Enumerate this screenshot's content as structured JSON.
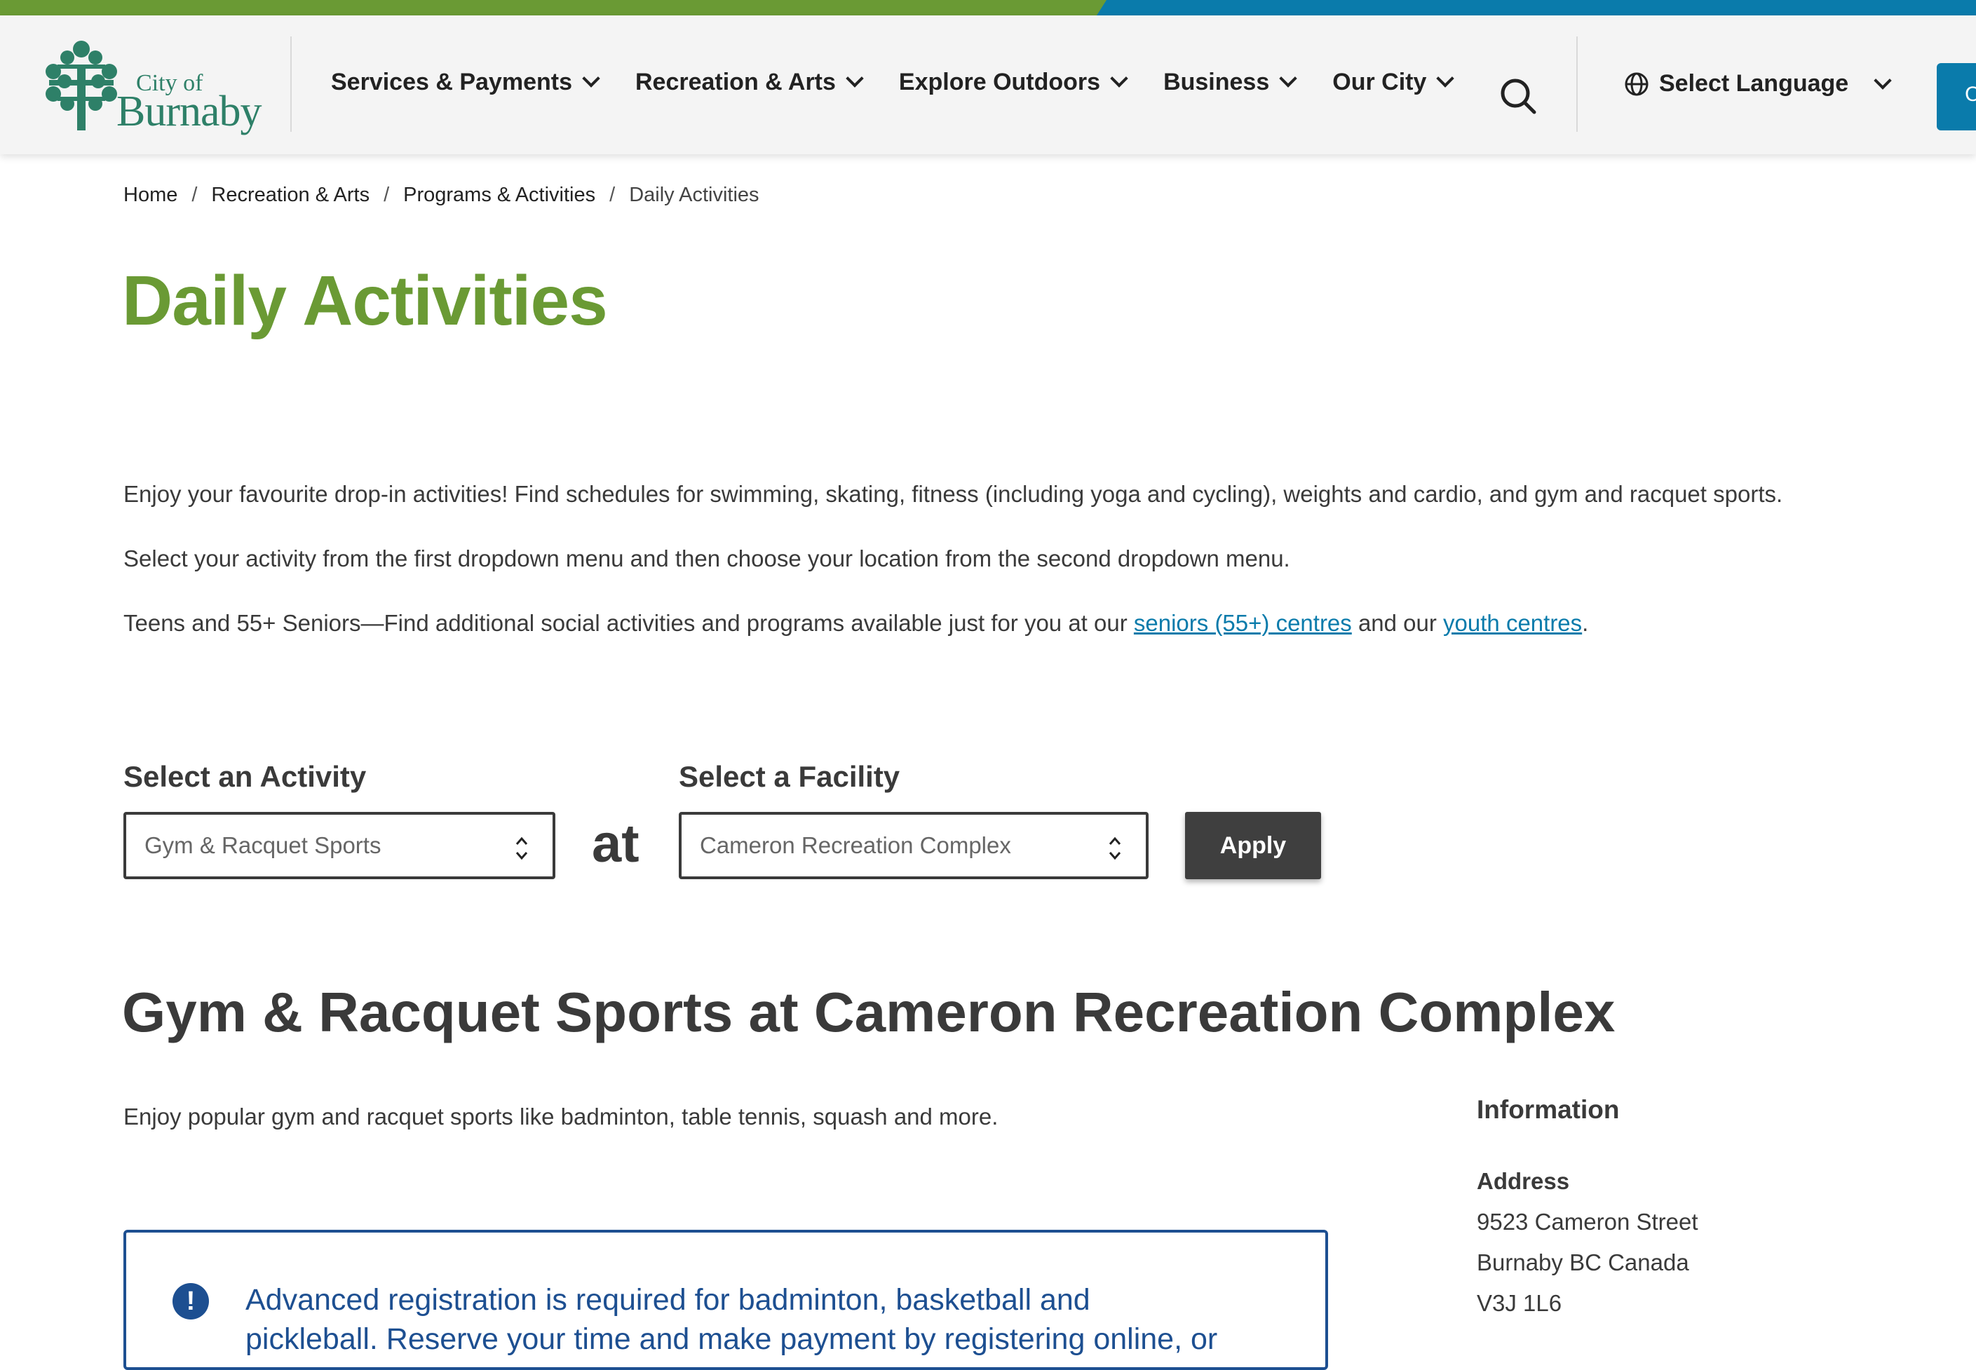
{
  "header": {
    "logo": {
      "line1": "City of",
      "line2": "Burnaby"
    },
    "nav": [
      {
        "label": "Services & Payments"
      },
      {
        "label": "Recreation & Arts"
      },
      {
        "label": "Explore Outdoors"
      },
      {
        "label": "Business"
      },
      {
        "label": "Our City"
      }
    ],
    "language_label": "Select Language",
    "cta_label": "C"
  },
  "breadcrumb": [
    "Home",
    "Recreation & Arts",
    "Programs & Activities",
    "Daily Activities"
  ],
  "page_title": "Daily Activities",
  "intro": {
    "p1": "Enjoy your favourite drop-in activities! Find schedules for swimming, skating, fitness (including yoga and cycling), weights and cardio, and gym and racquet sports.",
    "p2": "Select your activity from the first dropdown menu and then choose your location from the second dropdown menu.",
    "p3_before": "Teens and 55+ Seniors—Find additional social activities and programs available just for you at our ",
    "p3_link1": "seniors (55+) centres",
    "p3_middle": " and our ",
    "p3_link2": "youth centres",
    "p3_after": "."
  },
  "filters": {
    "activity_label": "Select an Activity",
    "activity_value": "Gym & Racquet Sports",
    "connector": "at",
    "facility_label": "Select a Facility",
    "facility_value": "Cameron Recreation Complex",
    "apply_label": "Apply"
  },
  "section": {
    "title": "Gym & Racquet Sports at Cameron Recreation Complex",
    "description": "Enjoy popular gym and racquet sports like badminton, table tennis, squash and more."
  },
  "alert": {
    "icon": "exclamation-icon",
    "text": "Advanced registration is required for badminton, basketball and pickleball. Reserve your time and make payment by registering online, or"
  },
  "information": {
    "title": "Information",
    "address_label": "Address",
    "address_lines": [
      "9523 Cameron Street",
      "Burnaby BC Canada",
      "V3J 1L6"
    ]
  },
  "colors": {
    "brand_green": "#6a9a34",
    "brand_blue": "#0a7bab",
    "alert_blue": "#1d4f91",
    "text": "#3a3a3a"
  }
}
